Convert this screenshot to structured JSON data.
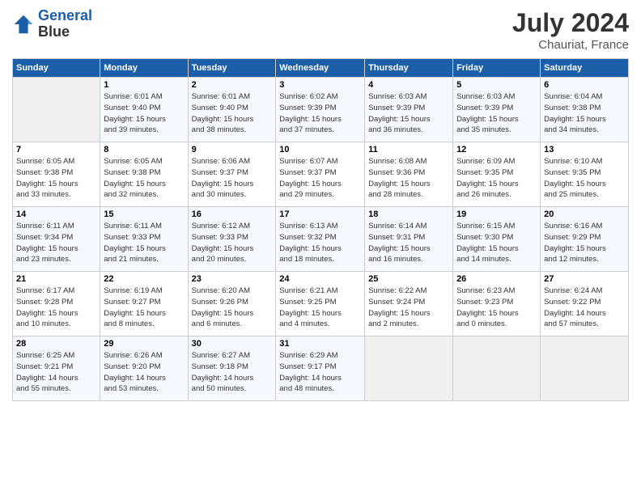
{
  "logo": {
    "line1": "General",
    "line2": "Blue"
  },
  "title": "July 2024",
  "location": "Chauriat, France",
  "days_of_week": [
    "Sunday",
    "Monday",
    "Tuesday",
    "Wednesday",
    "Thursday",
    "Friday",
    "Saturday"
  ],
  "weeks": [
    [
      {
        "num": "",
        "info": ""
      },
      {
        "num": "1",
        "info": "Sunrise: 6:01 AM\nSunset: 9:40 PM\nDaylight: 15 hours\nand 39 minutes."
      },
      {
        "num": "2",
        "info": "Sunrise: 6:01 AM\nSunset: 9:40 PM\nDaylight: 15 hours\nand 38 minutes."
      },
      {
        "num": "3",
        "info": "Sunrise: 6:02 AM\nSunset: 9:39 PM\nDaylight: 15 hours\nand 37 minutes."
      },
      {
        "num": "4",
        "info": "Sunrise: 6:03 AM\nSunset: 9:39 PM\nDaylight: 15 hours\nand 36 minutes."
      },
      {
        "num": "5",
        "info": "Sunrise: 6:03 AM\nSunset: 9:39 PM\nDaylight: 15 hours\nand 35 minutes."
      },
      {
        "num": "6",
        "info": "Sunrise: 6:04 AM\nSunset: 9:38 PM\nDaylight: 15 hours\nand 34 minutes."
      }
    ],
    [
      {
        "num": "7",
        "info": "Sunrise: 6:05 AM\nSunset: 9:38 PM\nDaylight: 15 hours\nand 33 minutes."
      },
      {
        "num": "8",
        "info": "Sunrise: 6:05 AM\nSunset: 9:38 PM\nDaylight: 15 hours\nand 32 minutes."
      },
      {
        "num": "9",
        "info": "Sunrise: 6:06 AM\nSunset: 9:37 PM\nDaylight: 15 hours\nand 30 minutes."
      },
      {
        "num": "10",
        "info": "Sunrise: 6:07 AM\nSunset: 9:37 PM\nDaylight: 15 hours\nand 29 minutes."
      },
      {
        "num": "11",
        "info": "Sunrise: 6:08 AM\nSunset: 9:36 PM\nDaylight: 15 hours\nand 28 minutes."
      },
      {
        "num": "12",
        "info": "Sunrise: 6:09 AM\nSunset: 9:35 PM\nDaylight: 15 hours\nand 26 minutes."
      },
      {
        "num": "13",
        "info": "Sunrise: 6:10 AM\nSunset: 9:35 PM\nDaylight: 15 hours\nand 25 minutes."
      }
    ],
    [
      {
        "num": "14",
        "info": "Sunrise: 6:11 AM\nSunset: 9:34 PM\nDaylight: 15 hours\nand 23 minutes."
      },
      {
        "num": "15",
        "info": "Sunrise: 6:11 AM\nSunset: 9:33 PM\nDaylight: 15 hours\nand 21 minutes."
      },
      {
        "num": "16",
        "info": "Sunrise: 6:12 AM\nSunset: 9:33 PM\nDaylight: 15 hours\nand 20 minutes."
      },
      {
        "num": "17",
        "info": "Sunrise: 6:13 AM\nSunset: 9:32 PM\nDaylight: 15 hours\nand 18 minutes."
      },
      {
        "num": "18",
        "info": "Sunrise: 6:14 AM\nSunset: 9:31 PM\nDaylight: 15 hours\nand 16 minutes."
      },
      {
        "num": "19",
        "info": "Sunrise: 6:15 AM\nSunset: 9:30 PM\nDaylight: 15 hours\nand 14 minutes."
      },
      {
        "num": "20",
        "info": "Sunrise: 6:16 AM\nSunset: 9:29 PM\nDaylight: 15 hours\nand 12 minutes."
      }
    ],
    [
      {
        "num": "21",
        "info": "Sunrise: 6:17 AM\nSunset: 9:28 PM\nDaylight: 15 hours\nand 10 minutes."
      },
      {
        "num": "22",
        "info": "Sunrise: 6:19 AM\nSunset: 9:27 PM\nDaylight: 15 hours\nand 8 minutes."
      },
      {
        "num": "23",
        "info": "Sunrise: 6:20 AM\nSunset: 9:26 PM\nDaylight: 15 hours\nand 6 minutes."
      },
      {
        "num": "24",
        "info": "Sunrise: 6:21 AM\nSunset: 9:25 PM\nDaylight: 15 hours\nand 4 minutes."
      },
      {
        "num": "25",
        "info": "Sunrise: 6:22 AM\nSunset: 9:24 PM\nDaylight: 15 hours\nand 2 minutes."
      },
      {
        "num": "26",
        "info": "Sunrise: 6:23 AM\nSunset: 9:23 PM\nDaylight: 15 hours\nand 0 minutes."
      },
      {
        "num": "27",
        "info": "Sunrise: 6:24 AM\nSunset: 9:22 PM\nDaylight: 14 hours\nand 57 minutes."
      }
    ],
    [
      {
        "num": "28",
        "info": "Sunrise: 6:25 AM\nSunset: 9:21 PM\nDaylight: 14 hours\nand 55 minutes."
      },
      {
        "num": "29",
        "info": "Sunrise: 6:26 AM\nSunset: 9:20 PM\nDaylight: 14 hours\nand 53 minutes."
      },
      {
        "num": "30",
        "info": "Sunrise: 6:27 AM\nSunset: 9:18 PM\nDaylight: 14 hours\nand 50 minutes."
      },
      {
        "num": "31",
        "info": "Sunrise: 6:29 AM\nSunset: 9:17 PM\nDaylight: 14 hours\nand 48 minutes."
      },
      {
        "num": "",
        "info": ""
      },
      {
        "num": "",
        "info": ""
      },
      {
        "num": "",
        "info": ""
      }
    ]
  ]
}
